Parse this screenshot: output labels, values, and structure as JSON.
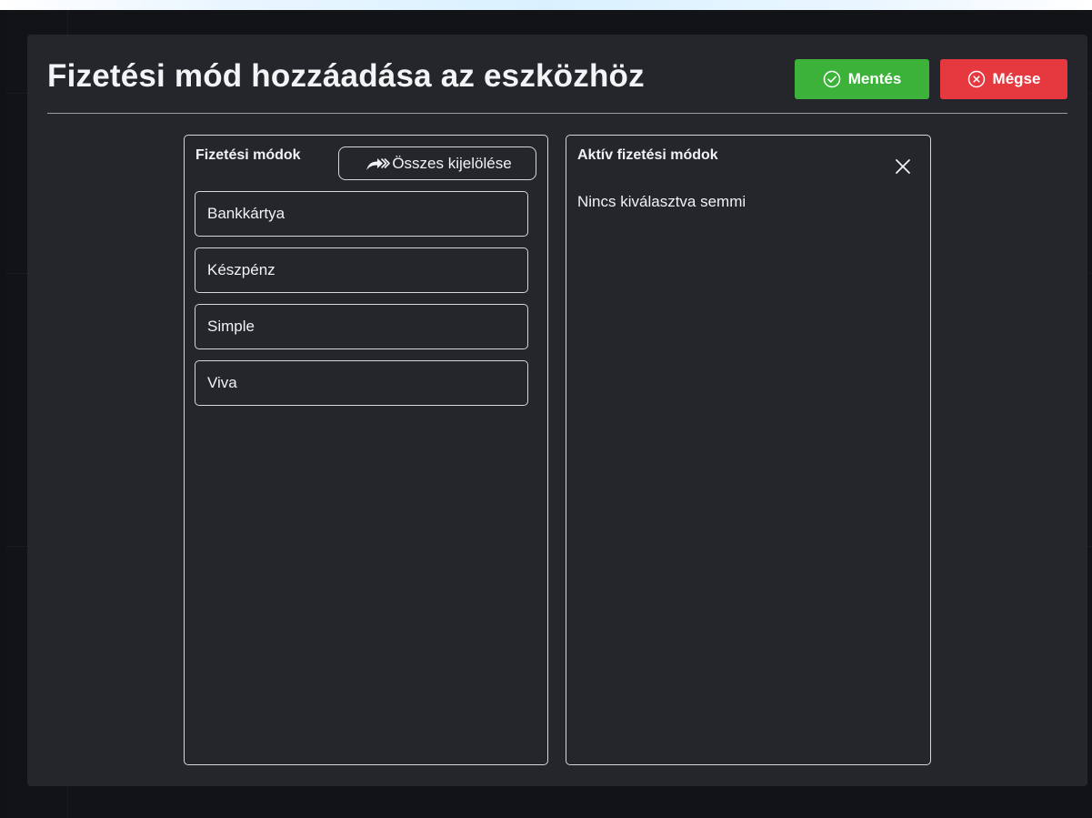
{
  "dialog": {
    "title": "Fizetési mód hozzáadása az eszközhöz",
    "save_label": "Mentés",
    "cancel_label": "Mégse",
    "save_color": "#3cb23a",
    "cancel_color": "#e5383f",
    "save_icon": "check-circle-icon",
    "cancel_icon": "x-circle-icon"
  },
  "available_panel": {
    "header": "Fizetési módok",
    "select_all_label": "Összes kijelölése",
    "select_all_icon": "forward-arrow-icon",
    "items": [
      {
        "label": "Bankkártya"
      },
      {
        "label": "Készpénz"
      },
      {
        "label": "Simple"
      },
      {
        "label": "Viva"
      }
    ]
  },
  "active_panel": {
    "header": "Aktív fizetési módok",
    "empty_text": "Nincs kiválasztva semmi",
    "close_icon": "close-icon"
  }
}
